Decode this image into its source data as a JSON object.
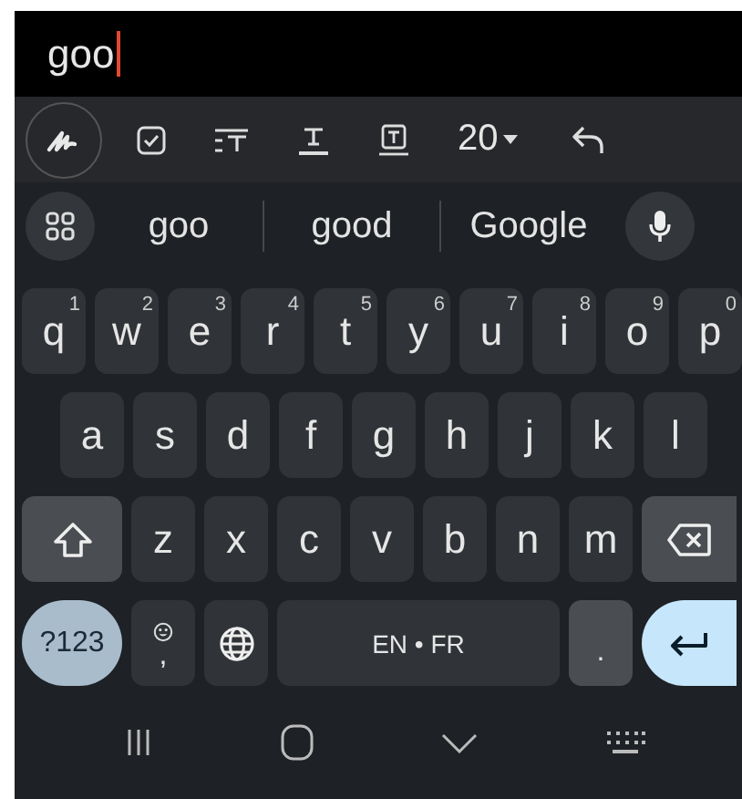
{
  "text_field": {
    "value": "goo"
  },
  "toolbar": {
    "font_size": "20"
  },
  "suggestions": [
    "goo",
    "good",
    "Google"
  ],
  "keyboard": {
    "rows": [
      [
        {
          "kind": "letter",
          "label": "q",
          "hint": "1"
        },
        {
          "kind": "letter",
          "label": "w",
          "hint": "2"
        },
        {
          "kind": "letter",
          "label": "e",
          "hint": "3"
        },
        {
          "kind": "letter",
          "label": "r",
          "hint": "4"
        },
        {
          "kind": "letter",
          "label": "t",
          "hint": "5"
        },
        {
          "kind": "letter",
          "label": "y",
          "hint": "6"
        },
        {
          "kind": "letter",
          "label": "u",
          "hint": "7"
        },
        {
          "kind": "letter",
          "label": "i",
          "hint": "8"
        },
        {
          "kind": "letter",
          "label": "o",
          "hint": "9"
        },
        {
          "kind": "letter",
          "label": "p",
          "hint": "0"
        }
      ],
      [
        {
          "kind": "letter",
          "label": "a"
        },
        {
          "kind": "letter",
          "label": "s"
        },
        {
          "kind": "letter",
          "label": "d"
        },
        {
          "kind": "letter",
          "label": "f"
        },
        {
          "kind": "letter",
          "label": "g"
        },
        {
          "kind": "letter",
          "label": "h"
        },
        {
          "kind": "letter",
          "label": "j"
        },
        {
          "kind": "letter",
          "label": "k"
        },
        {
          "kind": "letter",
          "label": "l"
        }
      ],
      [
        {
          "kind": "shift"
        },
        {
          "kind": "letter",
          "label": "z"
        },
        {
          "kind": "letter",
          "label": "x"
        },
        {
          "kind": "letter",
          "label": "c"
        },
        {
          "kind": "letter",
          "label": "v"
        },
        {
          "kind": "letter",
          "label": "b"
        },
        {
          "kind": "letter",
          "label": "n"
        },
        {
          "kind": "letter",
          "label": "m"
        },
        {
          "kind": "backspace"
        }
      ]
    ],
    "bottom_keys": [
      {
        "kind": "symbols",
        "label": "?123"
      },
      {
        "kind": "emoji",
        "label": ","
      },
      {
        "kind": "globe"
      },
      {
        "kind": "space",
        "label": "EN • FR"
      },
      {
        "kind": "period",
        "label": "."
      },
      {
        "kind": "enter"
      }
    ]
  }
}
